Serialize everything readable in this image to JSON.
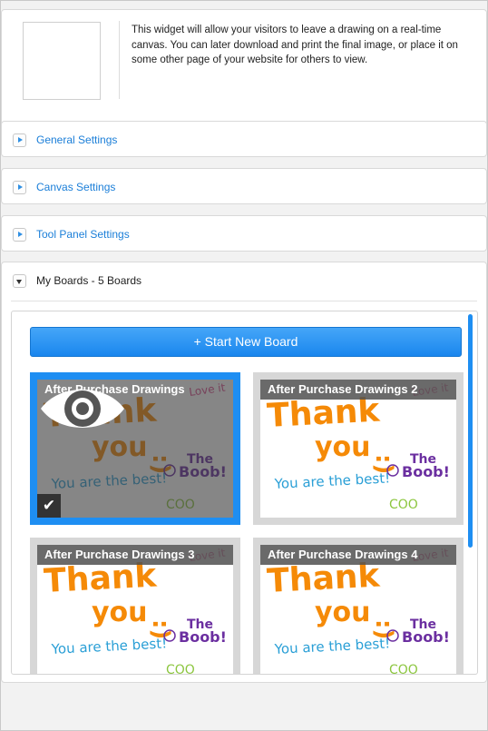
{
  "intro": {
    "description": "This widget will allow your visitors to leave a drawing on a real-time canvas. You can later download and print the final image, or place it on some other page of your website for others to view."
  },
  "sections": {
    "general": "General Settings",
    "canvas": "Canvas Settings",
    "tool_panel": "Tool Panel Settings",
    "my_boards": "My Boards - 5 Boards"
  },
  "boards": {
    "start_button": "+ Start New Board",
    "items": [
      {
        "title": "After Purchase Drawings",
        "selected": true
      },
      {
        "title": "After Purchase Drawings 2",
        "selected": false
      },
      {
        "title": "After Purchase Drawings 3",
        "selected": false
      },
      {
        "title": "After Purchase Drawings 4",
        "selected": false
      }
    ]
  },
  "drawing": {
    "line1": "Thank",
    "line2": "you",
    "smiley": ":)",
    "signature_the": "The",
    "signature_name": "Boob!",
    "subtitle": "You are the best!",
    "corner_note": "Love it",
    "doodle": "COO"
  },
  "colors": {
    "accent_blue": "#1e8ef2",
    "link_blue": "#1a7ed8",
    "drawing_orange": "#f58a07",
    "drawing_purple": "#6b2fa0",
    "drawing_cyan": "#2a9fd6",
    "drawing_green": "#8cc63f",
    "drawing_pink": "#d94a8c"
  },
  "icons": {
    "collapsed": "triangle-right-icon",
    "expanded": "triangle-down-icon",
    "view": "eye-icon",
    "selected": "checkmark-icon"
  }
}
